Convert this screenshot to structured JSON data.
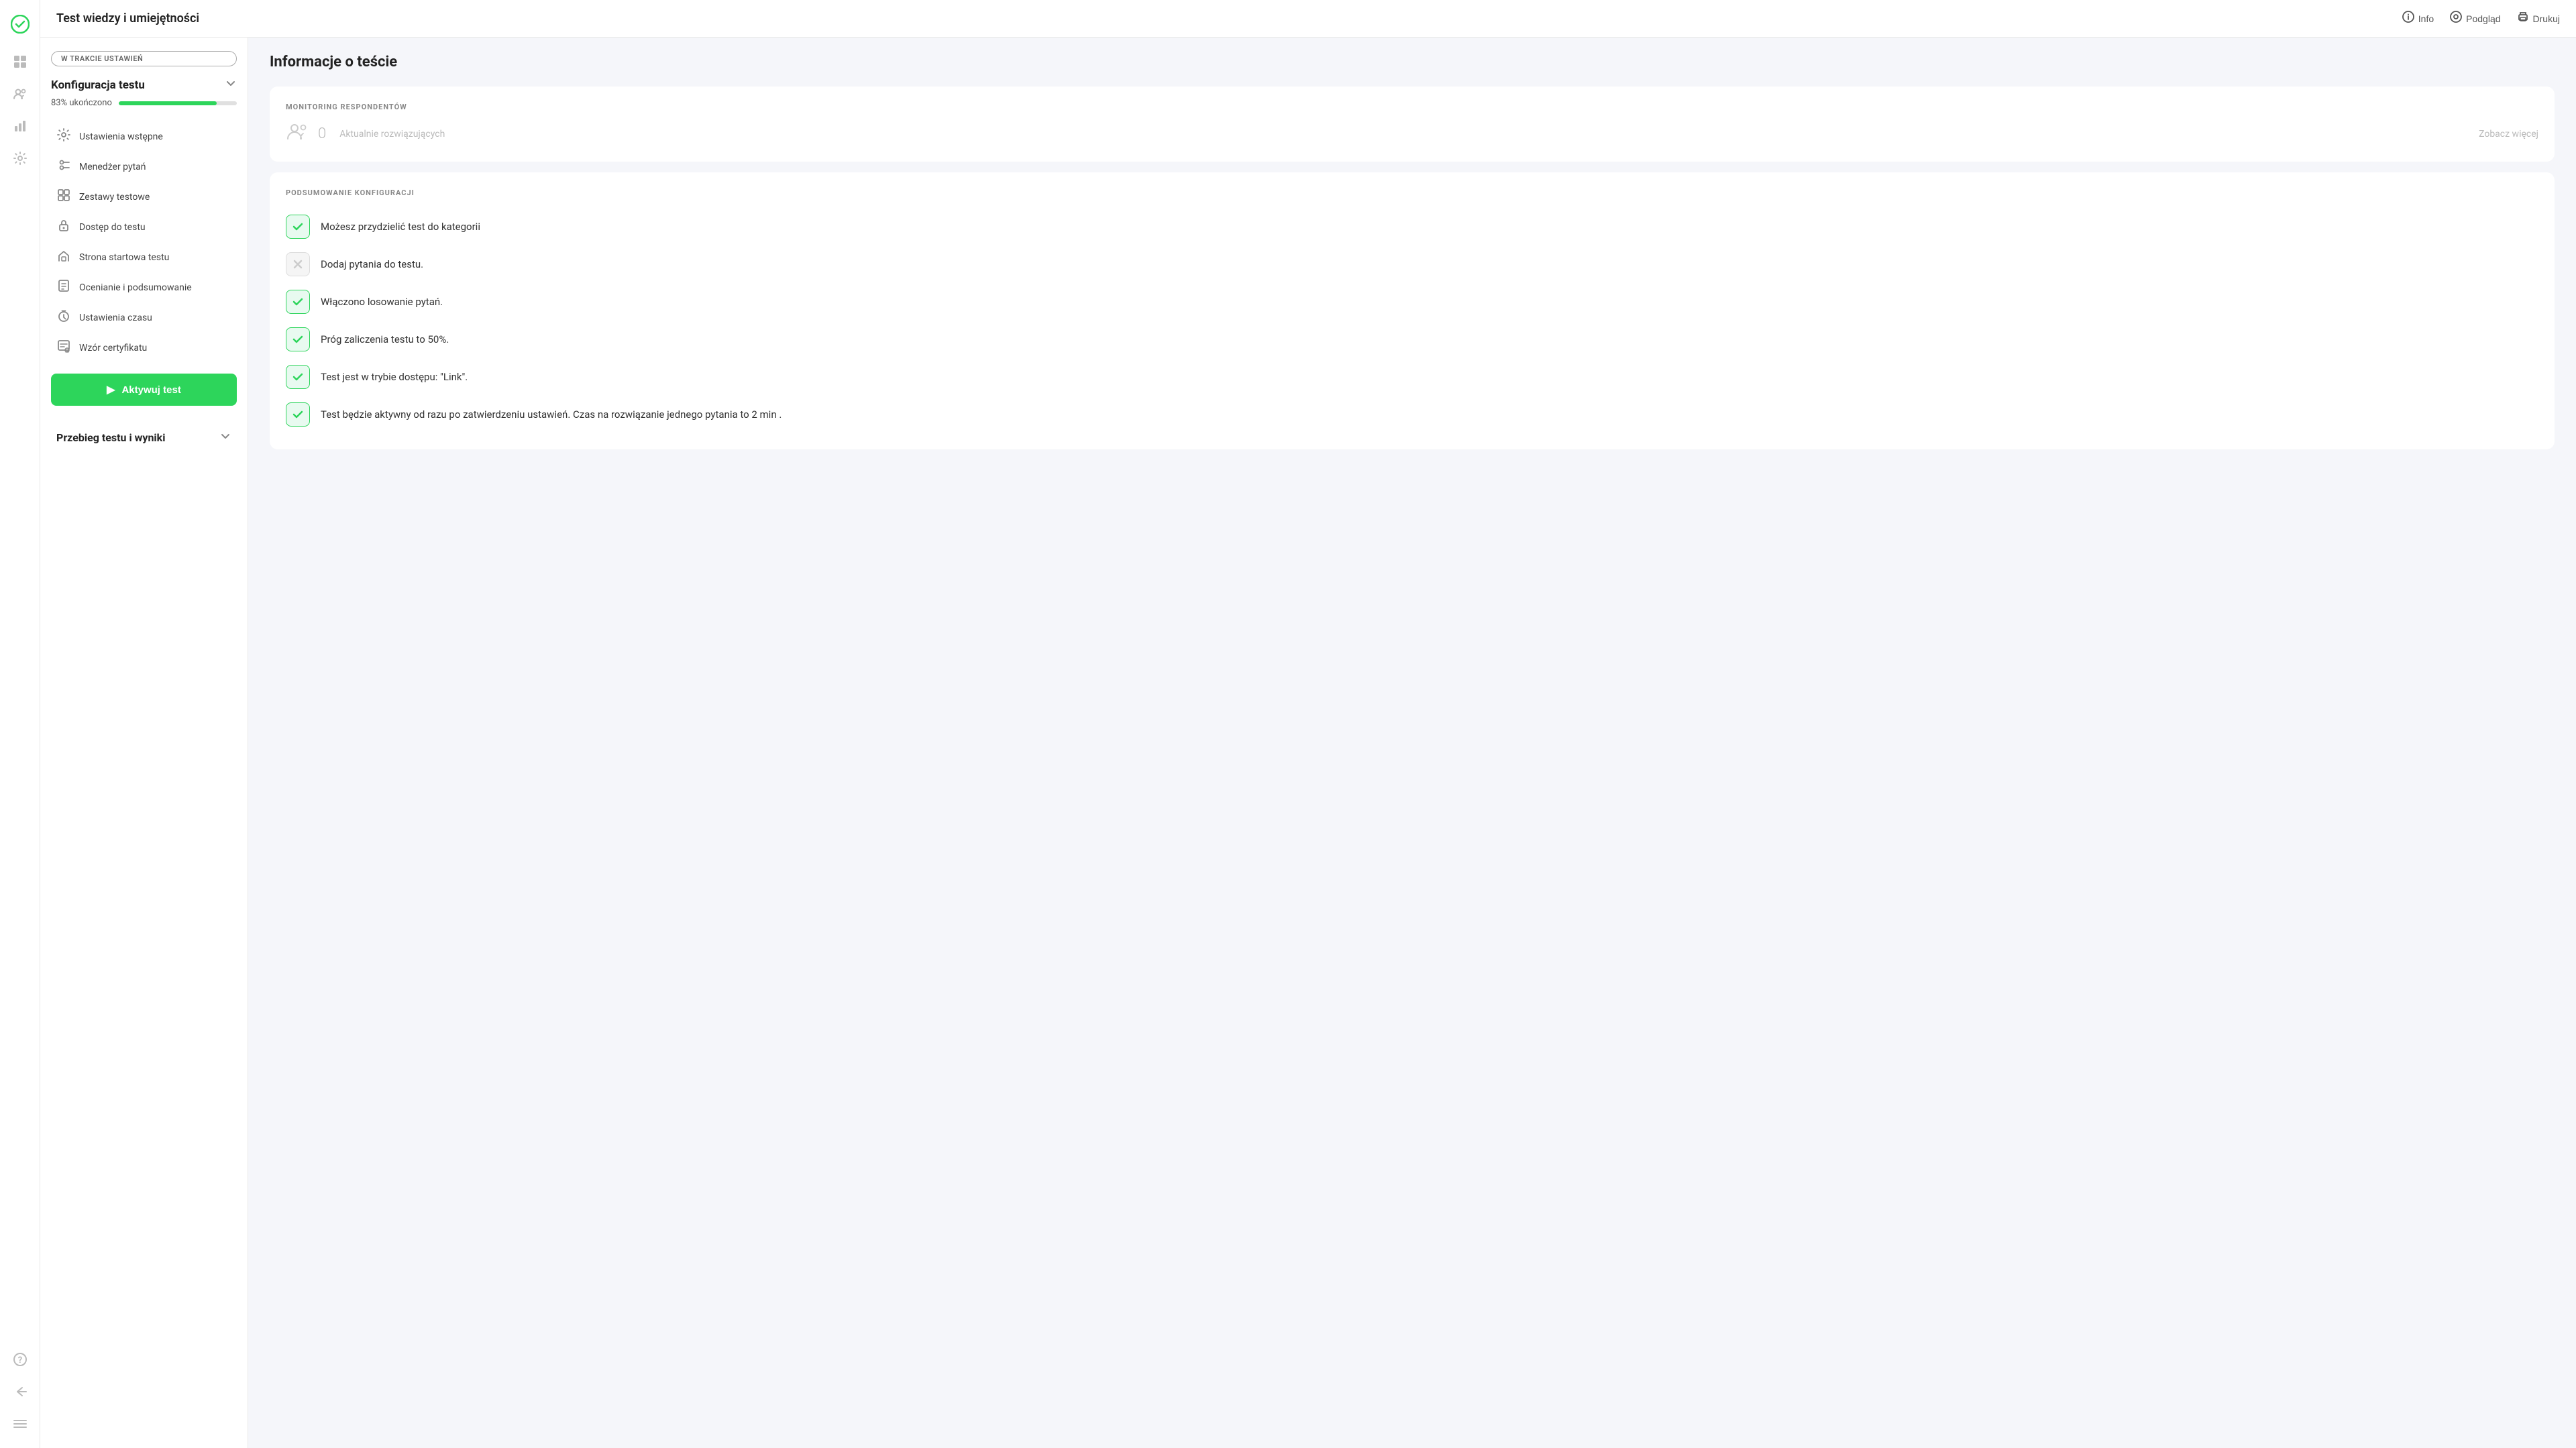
{
  "header": {
    "title": "Test wiedzy i umiejętności",
    "actions": {
      "info": "Info",
      "preview": "Podgląd",
      "print": "Drukuj"
    }
  },
  "sidebar_icons": [
    {
      "name": "logo-icon",
      "symbol": "✓",
      "active": true
    },
    {
      "name": "grid-icon",
      "symbol": "⊞",
      "active": false
    },
    {
      "name": "users-icon",
      "symbol": "👥",
      "active": false
    },
    {
      "name": "chart-icon",
      "symbol": "📊",
      "active": false
    },
    {
      "name": "settings-icon",
      "symbol": "⚙",
      "active": false
    },
    {
      "name": "help-icon",
      "symbol": "?",
      "active": false
    },
    {
      "name": "back-icon",
      "symbol": "↩",
      "active": false
    },
    {
      "name": "collapse-icon",
      "symbol": "»",
      "active": false
    }
  ],
  "left_panel": {
    "status_badge": "W TRAKCIE USTAWIEŃ",
    "config_section": {
      "title": "Konfiguracja testu",
      "progress_label": "83% ukończono",
      "progress_value": 83
    },
    "nav_items": [
      {
        "label": "Ustawienia wstępne",
        "icon": "⚙"
      },
      {
        "label": "Menedżer pytań",
        "icon": "≋"
      },
      {
        "label": "Zestawy testowe",
        "icon": "⊞"
      },
      {
        "label": "Dostęp do testu",
        "icon": "🔒"
      },
      {
        "label": "Strona startowa testu",
        "icon": "🏠"
      },
      {
        "label": "Ocenianie i podsumowanie",
        "icon": "📋"
      },
      {
        "label": "Ustawienia czasu",
        "icon": "🕐"
      },
      {
        "label": "Wzór certyfikatu",
        "icon": "📜"
      }
    ],
    "activate_button": "Aktywuj test",
    "results_section": {
      "title": "Przebieg testu i wyniki"
    }
  },
  "right_panel": {
    "page_title": "Informacje o teście",
    "monitoring_card": {
      "section_label": "MONITORING RESPONDENTÓW",
      "count": "0",
      "label": "Aktualnie rozwiązujących",
      "see_more": "Zobacz więcej"
    },
    "summary_card": {
      "section_label": "PODSUMOWANIE KONFIGURACJI",
      "items": [
        {
          "status": "green",
          "text": "Możesz przydzielić test do kategorii"
        },
        {
          "status": "gray",
          "text": "Dodaj pytania do testu."
        },
        {
          "status": "green",
          "text": "Włączono losowanie pytań."
        },
        {
          "status": "green",
          "text": "Próg zaliczenia testu to 50%."
        },
        {
          "status": "green",
          "text": "Test jest w trybie dostępu: \"Link\"."
        },
        {
          "status": "green",
          "text": "Test będzie aktywny od razu po zatwierdzeniu ustawień. Czas na rozwiązanie jednego pytania to 2 min ."
        }
      ]
    }
  }
}
